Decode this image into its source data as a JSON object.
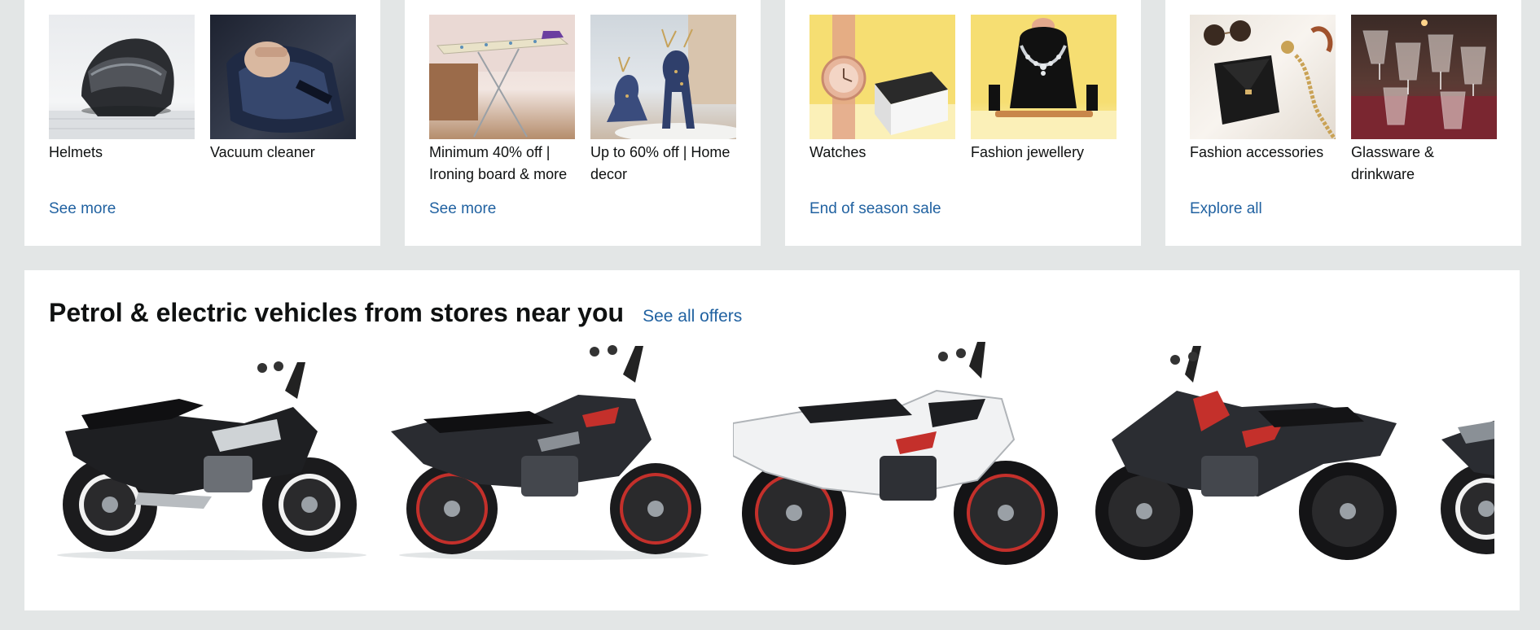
{
  "cards": [
    {
      "tiles": [
        {
          "label": "Helmets",
          "icon": "helmet-image"
        },
        {
          "label": "Vacuum cleaner",
          "icon": "vacuum-cleaner-image"
        }
      ],
      "link": "See more"
    },
    {
      "tiles": [
        {
          "label": "Minimum 40% off | Ironing board & more",
          "icon": "ironing-board-image"
        },
        {
          "label": "Up to 60% off | Home decor",
          "icon": "deer-figurine-image"
        }
      ],
      "link": "See more"
    },
    {
      "tiles": [
        {
          "label": "Watches",
          "icon": "watch-image"
        },
        {
          "label": "Fashion jewellery",
          "icon": "necklace-image"
        }
      ],
      "link": "End of season sale"
    },
    {
      "tiles": [
        {
          "label": "Fashion accessories",
          "icon": "accessories-image"
        },
        {
          "label": "Glassware & drinkware",
          "icon": "glassware-image"
        }
      ],
      "link": "Explore all"
    }
  ],
  "vehicles": {
    "title": "Petrol & electric vehicles from stores near you",
    "link": "See all offers",
    "items": [
      {
        "icon": "commuter-motorcycle-image",
        "accent": "#cfd3d6"
      },
      {
        "icon": "street-motorcycle-image",
        "accent": "#c4302b"
      },
      {
        "icon": "white-sport-motorcycle-image",
        "accent": "#c4302b"
      },
      {
        "icon": "black-sport-motorcycle-image",
        "accent": "#c4302b"
      },
      {
        "icon": "partial-motorcycle-image",
        "accent": "#8a9096"
      }
    ]
  },
  "colors": {
    "page_bg": "#e3e6e6",
    "link": "#2162a1",
    "text": "#0f1111"
  }
}
